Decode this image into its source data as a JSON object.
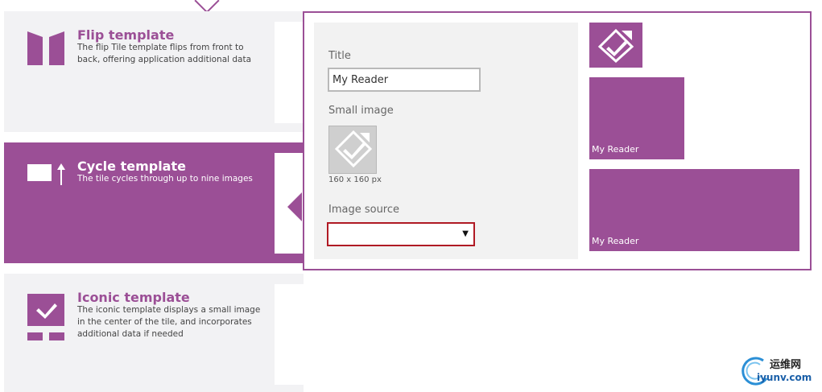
{
  "templates": {
    "flip": {
      "title": "Flip template",
      "description": "The flip Tile template flips from front to back, offering application additional data"
    },
    "cycle": {
      "title": "Cycle template",
      "description": "The tile cycles through up to nine images"
    },
    "iconic": {
      "title": "Iconic template",
      "description": "The iconic template displays a small image in the center of the tile, and incorporates additional data if needed"
    }
  },
  "editor": {
    "title_label": "Title",
    "title_value": "My Reader",
    "small_image_label": "Small image",
    "small_image_size": "160 x 160 px",
    "image_source_label": "Image source",
    "image_source_value": ""
  },
  "preview_tiles": {
    "medium_label": "My Reader",
    "wide_label": "My Reader"
  },
  "watermark": {
    "text_cn": "运维网",
    "text_en": "iyunv.com"
  },
  "colors": {
    "accent": "#9b4f96",
    "panel": "#f2f2f4",
    "error_border": "#b01a24"
  },
  "icons": [
    "flip-template-icon",
    "cycle-template-icon",
    "iconic-template-icon",
    "tile-check-icon",
    "dropdown-arrow-icon"
  ]
}
